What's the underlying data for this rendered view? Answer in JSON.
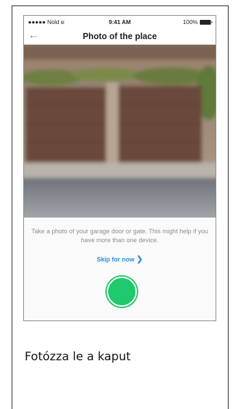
{
  "status_bar": {
    "carrier": "●●●●● Nold",
    "wifi_icon": "wifi-icon",
    "time": "9:41 AM",
    "battery": "100%"
  },
  "nav": {
    "back_icon": "back-arrow-icon",
    "title": "Photo of the place"
  },
  "photo": {
    "subject": "garage-door-photo"
  },
  "panel": {
    "instruction": "Take a photo of your garage door or gate. This might help if you have more than one device.",
    "skip_label": "Skip for now",
    "skip_icon": "chevron-right-icon",
    "capture_color": "#20c96b",
    "link_color": "#2b8fd6"
  },
  "caption": "Fotózza le a kaput"
}
